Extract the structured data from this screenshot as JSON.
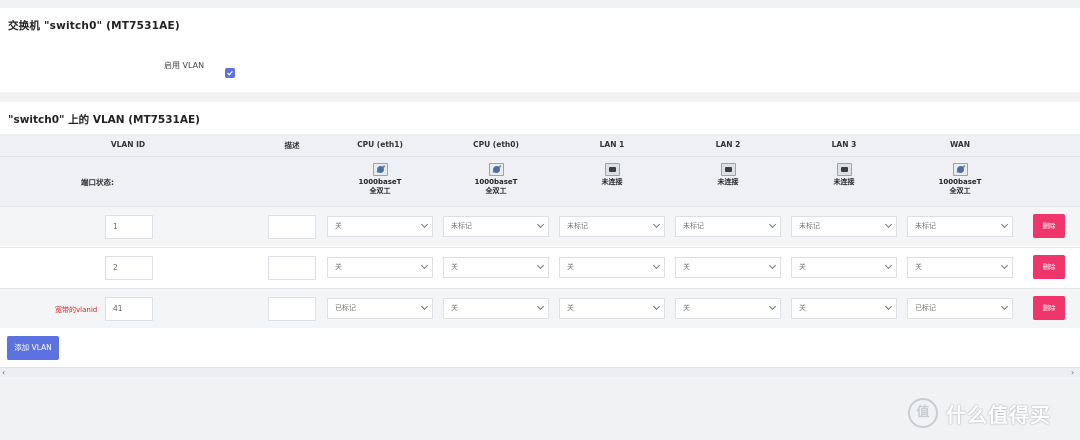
{
  "switch_section": {
    "title": "交换机 \"switch0\" (MT7531AE)",
    "enable_vlan_label": "启用 VLAN",
    "enable_vlan_checked": true
  },
  "vlan_section": {
    "title": "\"switch0\" 上的 VLAN (MT7531AE)",
    "columns": {
      "vlan_id": "VLAN ID",
      "desc": "描述",
      "cpu_eth1": "CPU (eth1)",
      "cpu_eth0": "CPU (eth0)",
      "lan1": "LAN 1",
      "lan2": "LAN 2",
      "lan3": "LAN 3",
      "wan": "WAN"
    },
    "port_status_label": "端口状态:",
    "port_status": {
      "cpu_eth1": {
        "line1": "1000baseT",
        "line2": "全双工",
        "icon": "ethernet-port-connected-icon"
      },
      "cpu_eth0": {
        "line1": "1000baseT",
        "line2": "全双工",
        "icon": "ethernet-port-connected-icon"
      },
      "lan1": {
        "line1": "未连接",
        "line2": "",
        "icon": "ethernet-port-disconnected-icon"
      },
      "lan2": {
        "line1": "未连接",
        "line2": "",
        "icon": "ethernet-port-disconnected-icon"
      },
      "lan3": {
        "line1": "未连接",
        "line2": "",
        "icon": "ethernet-port-disconnected-icon"
      },
      "wan": {
        "line1": "1000baseT",
        "line2": "全双工",
        "icon": "ethernet-port-connected-icon"
      }
    },
    "rows": [
      {
        "label": "",
        "vlan_id": "1",
        "desc": "",
        "cpu_eth1": "关",
        "cpu_eth0": "未标记",
        "lan1": "未标记",
        "lan2": "未标记",
        "lan3": "未标记",
        "wan": "未标记",
        "delete": "删除"
      },
      {
        "label": "",
        "vlan_id": "2",
        "desc": "",
        "cpu_eth1": "关",
        "cpu_eth0": "关",
        "lan1": "关",
        "lan2": "关",
        "lan3": "关",
        "wan": "关",
        "delete": "删除"
      },
      {
        "label": "宽带的vlanid",
        "vlan_id": "41",
        "desc": "",
        "cpu_eth1": "已标记",
        "cpu_eth0": "关",
        "lan1": "关",
        "lan2": "关",
        "lan3": "关",
        "wan": "已标记",
        "delete": "删除"
      }
    ],
    "add_button": "添加 VLAN"
  },
  "watermark": {
    "icon_text": "值",
    "text": "什么值得买"
  },
  "colors": {
    "primary": "#5b72e0",
    "danger": "#f0356a",
    "label_red": "#e02020"
  }
}
